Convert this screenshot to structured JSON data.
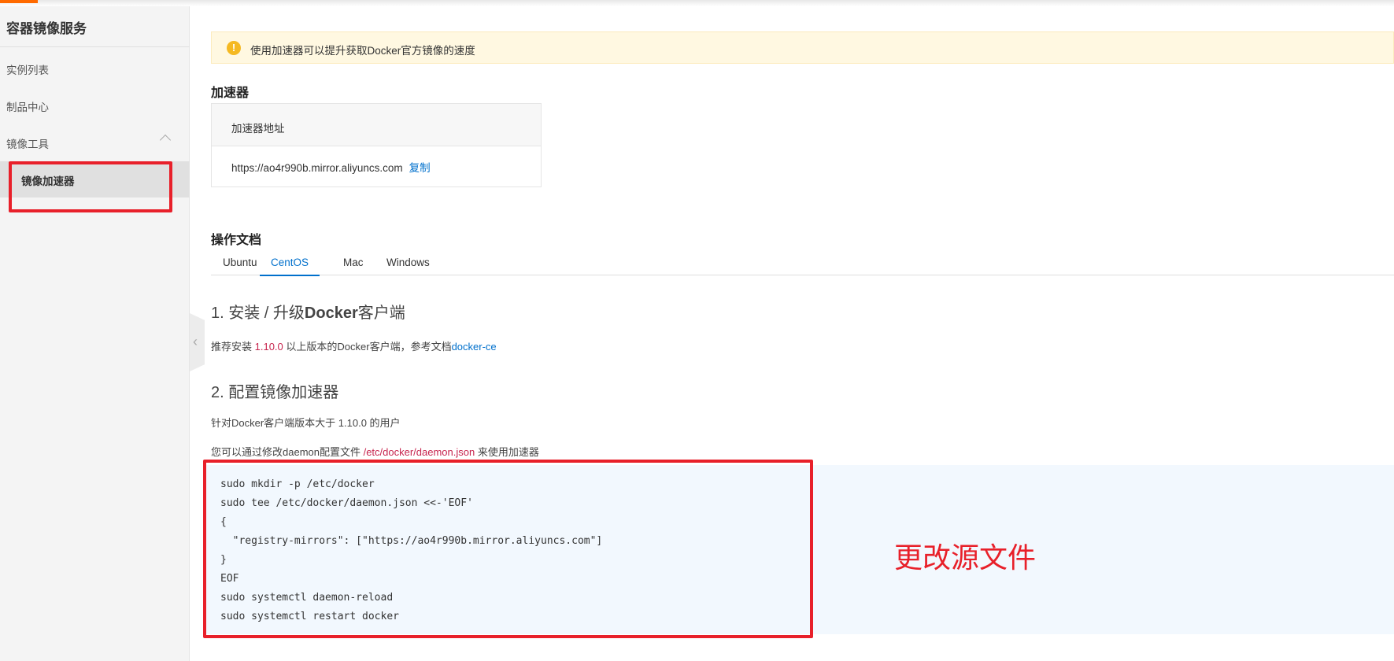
{
  "sidebar": {
    "title": "容器镜像服务",
    "items": [
      {
        "label": "实例列表"
      },
      {
        "label": "制品中心"
      },
      {
        "label": "镜像工具"
      },
      {
        "label": "镜像加速器"
      }
    ]
  },
  "notice": {
    "text": "使用加速器可以提升获取Docker官方镜像的速度"
  },
  "accelerator": {
    "heading": "加速器",
    "column": "加速器地址",
    "url": "https://ao4r990b.mirror.aliyuncs.com",
    "copy": "复制"
  },
  "docs": {
    "heading": "操作文档",
    "tabs": [
      "Ubuntu",
      "CentOS",
      "Mac",
      "Windows"
    ],
    "active_tab": "CentOS",
    "step1": {
      "num": "1. ",
      "title_a": "安装 / 升级",
      "title_b": "Docker",
      "title_c": "客户端",
      "p_a": "推荐安装 ",
      "version": "1.10.0",
      "p_b": " 以上版本的Docker客户端，参考文档",
      "link": "docker-ce"
    },
    "step2": {
      "title": "2. 配置镜像加速器",
      "p1": "针对Docker客户端版本大于 1.10.0 的用户",
      "p2_a": "您可以通过修改daemon配置文件 ",
      "path": "/etc/docker/daemon.json",
      "p2_b": " 来使用加速器"
    },
    "code": [
      "sudo mkdir -p /etc/docker",
      "sudo tee /etc/docker/daemon.json <<-'EOF'",
      "{",
      "  \"registry-mirrors\": [\"https://ao4r990b.mirror.aliyuncs.com\"]",
      "}",
      "EOF",
      "sudo systemctl daemon-reload",
      "sudo systemctl restart docker"
    ]
  },
  "annotation": {
    "text": "更改源文件",
    "color": "#e8202a"
  }
}
